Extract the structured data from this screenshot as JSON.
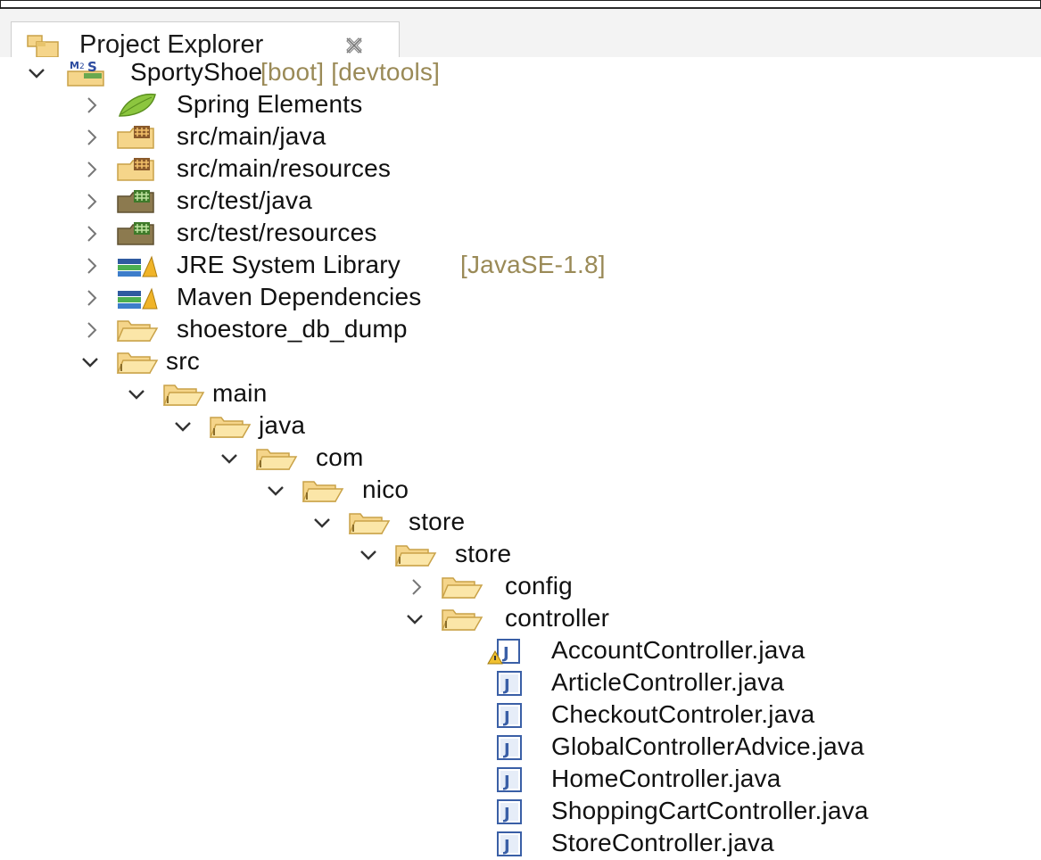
{
  "view": {
    "title": "Project Explorer",
    "title_icon": "project-explorer-icon",
    "close_icon": "close-icon"
  },
  "tree": {
    "project": {
      "label": "SportyShoe",
      "decorations": "[boot] [devtools]",
      "expanded": true
    },
    "nodes": [
      {
        "label": "Spring Elements",
        "icon": "spring-leaf-icon",
        "expanded": false
      },
      {
        "label": "src/main/java",
        "icon": "source-folder-icon",
        "expanded": false
      },
      {
        "label": "src/main/resources",
        "icon": "source-folder-icon",
        "expanded": false
      },
      {
        "label": "src/test/java",
        "icon": "test-source-folder-icon",
        "expanded": false
      },
      {
        "label": "src/test/resources",
        "icon": "test-source-folder-icon",
        "expanded": false
      },
      {
        "label": "JRE System Library",
        "decoration": "[JavaSE-1.8]",
        "icon": "library-icon",
        "expanded": false
      },
      {
        "label": "Maven Dependencies",
        "icon": "library-icon",
        "expanded": false
      },
      {
        "label": "shoestore_db_dump",
        "icon": "folder-icon",
        "expanded": false
      },
      {
        "label": "src",
        "icon": "folder-icon",
        "expanded": true
      },
      {
        "label": "main",
        "icon": "folder-icon",
        "expanded": true
      },
      {
        "label": "java",
        "icon": "folder-icon",
        "expanded": true
      },
      {
        "label": "com",
        "icon": "folder-icon",
        "expanded": true
      },
      {
        "label": "nico",
        "icon": "folder-icon",
        "expanded": true
      },
      {
        "label": "store",
        "icon": "folder-icon",
        "expanded": true
      },
      {
        "label": "store",
        "icon": "folder-icon",
        "expanded": true
      },
      {
        "label": "config",
        "icon": "folder-icon",
        "expanded": false
      },
      {
        "label": "controller",
        "icon": "folder-icon",
        "expanded": true
      },
      {
        "label": "AccountController.java",
        "icon": "java-file-warning-icon"
      },
      {
        "label": "ArticleController.java",
        "icon": "java-file-icon"
      },
      {
        "label": "CheckoutControler.java",
        "icon": "java-file-icon"
      },
      {
        "label": "GlobalControllerAdvice.java",
        "icon": "java-file-icon"
      },
      {
        "label": "HomeController.java",
        "icon": "java-file-icon"
      },
      {
        "label": "ShoppingCartController.java",
        "icon": "java-file-icon"
      },
      {
        "label": "StoreController.java",
        "icon": "java-file-icon"
      }
    ]
  },
  "colors": {
    "folder": "#f5d58a",
    "folder_edge": "#c9a248",
    "java_blue": "#3a5fa6",
    "decoration": "#9a8a57",
    "chevron": "#6b6b6b"
  }
}
